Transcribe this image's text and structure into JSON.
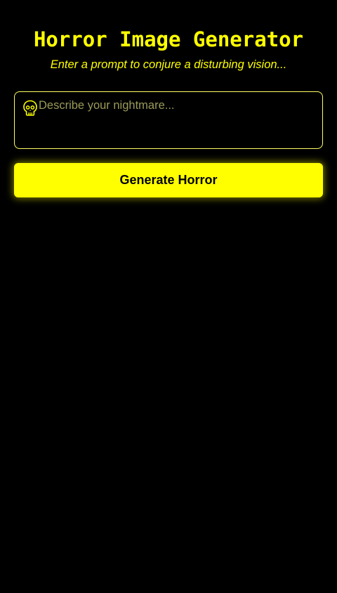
{
  "header": {
    "title": "Horror Image Generator",
    "subtitle": "Enter a prompt to conjure a disturbing vision..."
  },
  "prompt": {
    "icon": "skull-icon",
    "placeholder": "Describe your nightmare...",
    "value": ""
  },
  "actions": {
    "generate_label": "Generate Horror"
  },
  "theme": {
    "background": "#000000",
    "accent": "#ffff00",
    "button_text": "#000000"
  }
}
